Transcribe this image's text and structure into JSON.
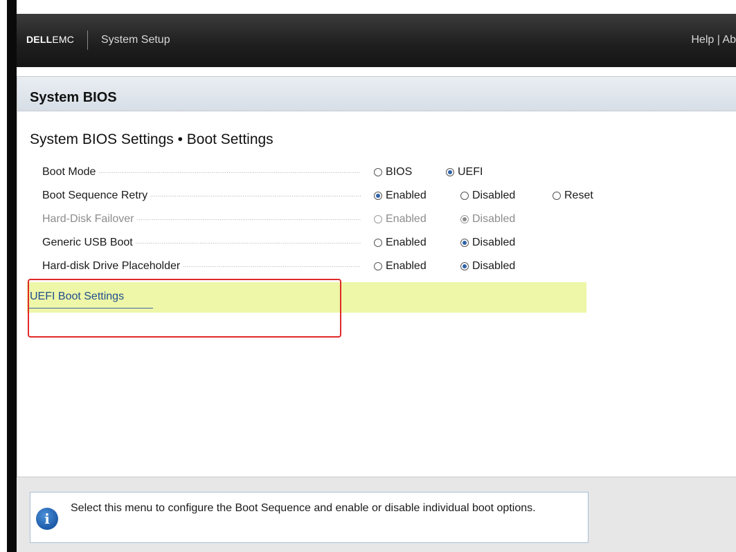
{
  "header": {
    "brand_dell": "DELL",
    "brand_emc": "EMC",
    "app_title": "System Setup",
    "help_links": "Help | Ab"
  },
  "panel": {
    "title": "System BIOS",
    "section_title": "System BIOS Settings • Boot Settings"
  },
  "settings": [
    {
      "label": "Boot Mode",
      "disabled": false,
      "options": [
        {
          "label": "BIOS",
          "checked": false
        },
        {
          "label": "UEFI",
          "checked": true
        }
      ]
    },
    {
      "label": "Boot Sequence Retry",
      "disabled": false,
      "options": [
        {
          "label": "Enabled",
          "checked": true
        },
        {
          "label": "Disabled",
          "checked": false
        },
        {
          "label": "Reset",
          "checked": false
        }
      ]
    },
    {
      "label": "Hard-Disk Failover",
      "disabled": true,
      "options": [
        {
          "label": "Enabled",
          "checked": false
        },
        {
          "label": "Disabled",
          "checked": true
        }
      ]
    },
    {
      "label": "Generic USB Boot",
      "disabled": false,
      "options": [
        {
          "label": "Enabled",
          "checked": false
        },
        {
          "label": "Disabled",
          "checked": true
        }
      ]
    },
    {
      "label": "Hard-disk Drive Placeholder",
      "disabled": false,
      "options": [
        {
          "label": "Enabled",
          "checked": false
        },
        {
          "label": "Disabled",
          "checked": true
        }
      ]
    }
  ],
  "submenu": {
    "label": "UEFI Boot Settings"
  },
  "info": {
    "icon": "info-icon",
    "icon_glyph": "i",
    "text": "Select this menu to configure the Boot Sequence and enable or disable individual boot options."
  },
  "colors": {
    "accent": "#2e62a6",
    "submenu_highlight": "#eef6a8",
    "annotation_box": "#e02828"
  }
}
